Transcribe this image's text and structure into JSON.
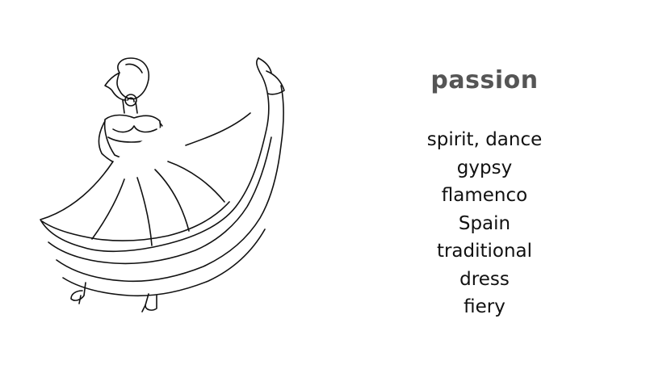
{
  "title": "passion",
  "words": [
    "spirit, dance",
    "gypsy",
    "flamenco",
    "Spain",
    "traditional",
    "dress",
    "fiery"
  ],
  "illustration": "line drawing"
}
